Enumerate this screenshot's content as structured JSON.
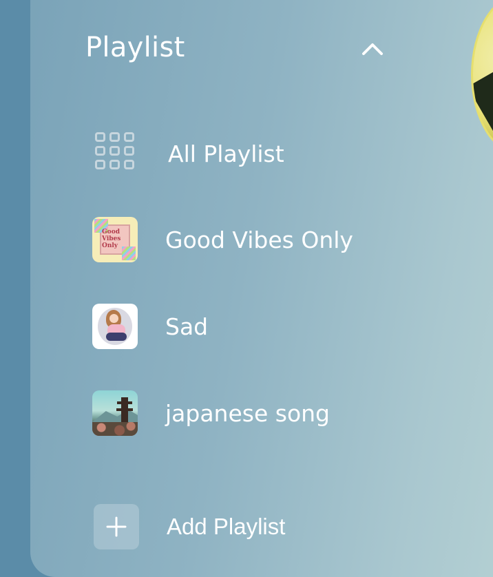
{
  "playlist": {
    "title": "Playlist",
    "collapse_icon": "chevron-up-icon",
    "items": [
      {
        "label": "All Playlist",
        "icon": "grid-icon"
      },
      {
        "label": "Good Vibes Only",
        "thumbnail_text": "Good Vibes Only"
      },
      {
        "label": "Sad"
      },
      {
        "label": "japanese song"
      }
    ],
    "add_label": "Add Playlist",
    "add_icon": "plus-icon"
  },
  "colors": {
    "background": "#5b8ca8",
    "text": "#ffffff",
    "avatar_accent": "#e6df6e"
  }
}
